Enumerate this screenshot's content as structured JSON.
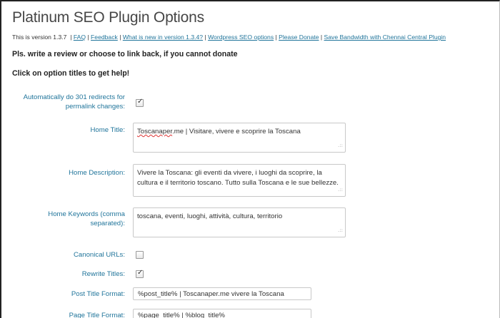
{
  "page": {
    "title": "Platinum SEO Plugin Options",
    "version_text": "This is version 1.3.7",
    "links": [
      "FAQ",
      "Feedback",
      "What is new in version 1.3.4?",
      "Wordpress SEO options",
      "Please Donate",
      "Save Bandwidth with Chennai Central Plugin"
    ],
    "review_note": "Pls. write a review or choose to link back, if you cannot donate",
    "help_note": "Click on option titles to get help!"
  },
  "options": {
    "redirects_label_line1": "Automatically do 301 redirects for",
    "redirects_label_line2": "permalink changes:",
    "redirects_checked": true,
    "home_title_label": "Home Title:",
    "home_title_highlight": "Toscanaper",
    "home_title_rest": ".me | Visitare, vivere e scoprire la Toscana",
    "home_description_label": "Home Description:",
    "home_description_value": "Vivere la Toscana: gli eventi da vivere, i luoghi da scoprire, la cultura e il territorio toscano. Tutto sulla Toscana e le sue bellezze.",
    "home_keywords_label_line1": "Home Keywords (comma",
    "home_keywords_label_line2": "separated):",
    "home_keywords_value": "toscana, eventi, luoghi, attività, cultura, territorio",
    "canonical_label": "Canonical URLs:",
    "canonical_checked": false,
    "rewrite_label": "Rewrite Titles:",
    "rewrite_checked": true,
    "post_title_label": "Post Title Format:",
    "post_title_value": "%post_title% | Toscanaper.me vivere la Toscana",
    "page_title_label": "Page Title Format:",
    "page_title_value": "%page_title% | %blog_title%"
  },
  "icons": {
    "checkmark": "checkmark-icon",
    "resize": "resize-grip-icon"
  }
}
